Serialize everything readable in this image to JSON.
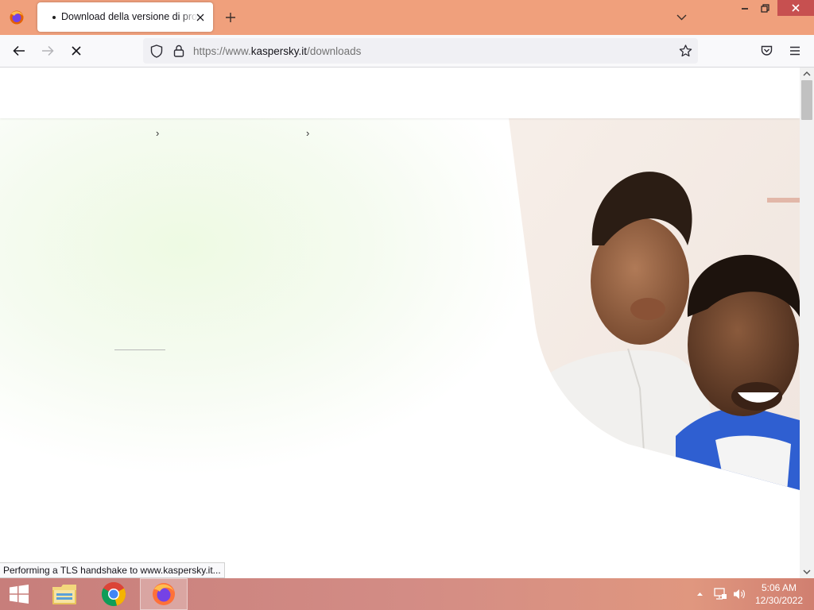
{
  "browser": {
    "tab": {
      "title": "Download della versione di prova gratuita"
    },
    "url": {
      "prefix": "https://www.",
      "domain": "kaspersky.it",
      "path": "/downloads"
    },
    "status_text": "Performing a TLS handshake to www.kaspersky.it..."
  },
  "page": {
    "breadcrumb_separators": [
      "›",
      "›"
    ],
    "hero_image": "smiling-father-and-child-photo"
  },
  "taskbar": {
    "apps": [
      "file-explorer",
      "google-chrome",
      "firefox"
    ],
    "active_app": "firefox",
    "clock": {
      "time": "5:06 AM",
      "date": "12/30/2022"
    }
  },
  "colors": {
    "tab_strip": "#f0a07c",
    "close_hover": "#c75050",
    "hero_tint": "#eefae3",
    "taskbar": "#d38c85"
  }
}
